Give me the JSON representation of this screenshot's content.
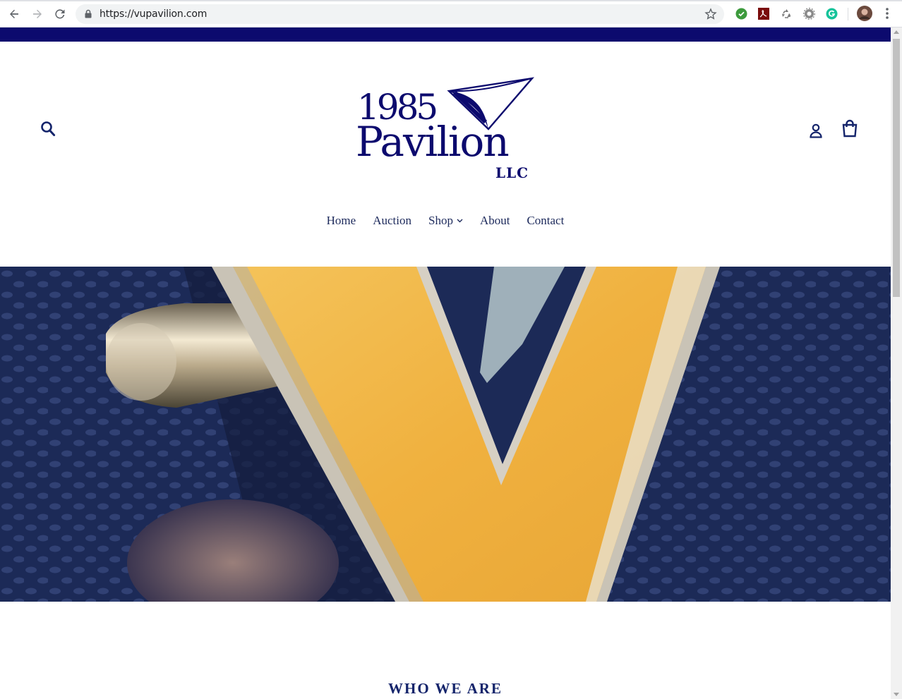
{
  "browser": {
    "url": "https://vupavilion.com",
    "extensions": [
      "check-circle-icon",
      "pdf-icon",
      "recycle-icon",
      "gear-icon",
      "grammarly-icon"
    ]
  },
  "site": {
    "logo": {
      "line1": "1985",
      "line2": "Pavilion",
      "line3": "LLC"
    },
    "nav": {
      "home": "Home",
      "auction": "Auction",
      "shop": "Shop",
      "about": "About",
      "contact": "Contact"
    },
    "section_title": "WHO WE ARE"
  },
  "colors": {
    "brand_navy": "#0c0a6e",
    "nav_text": "#1d2a5c",
    "hero_gold": "#f1b84a",
    "hero_blue": "#1f2d59"
  }
}
